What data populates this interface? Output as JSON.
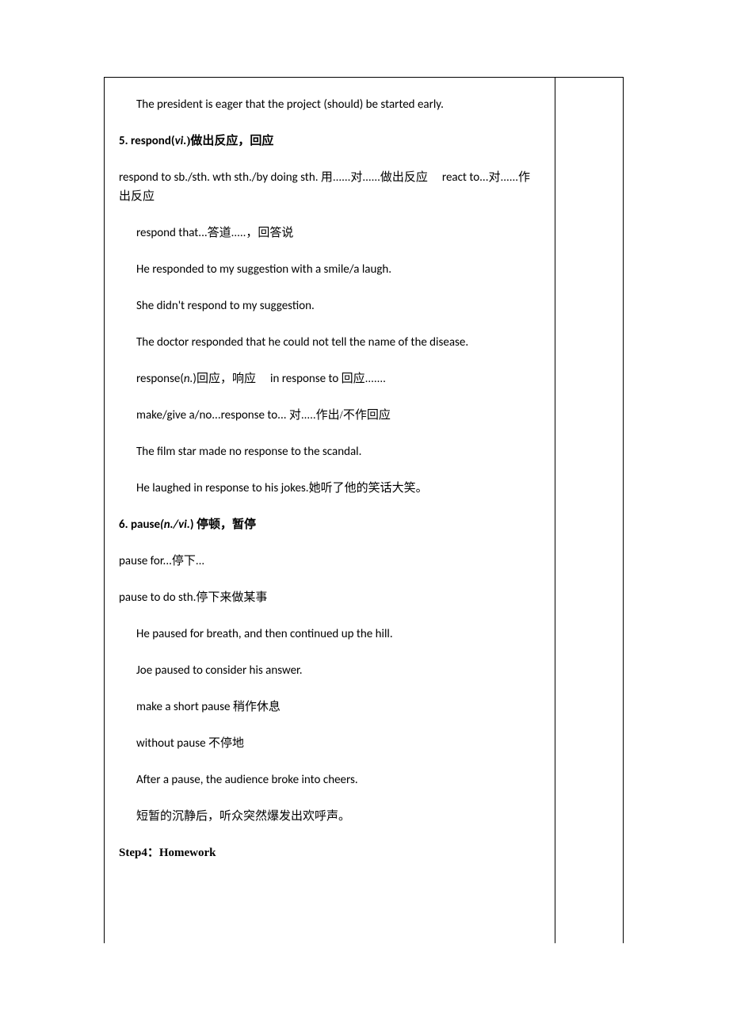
{
  "lines": [
    {
      "indent": true,
      "bold": false,
      "spans": [
        {
          "t": "The president is eager that the project (should) be started early."
        }
      ]
    },
    {
      "indent": false,
      "bold": true,
      "spans": [
        {
          "t": "5. respond("
        },
        {
          "t": "vi.",
          "italic": true
        },
        {
          "t": ")做出反应，回应",
          "cn": true
        }
      ]
    },
    {
      "indent": false,
      "bold": false,
      "spans": [
        {
          "t": "respond to sb./sth. wth sth./by doing sth. "
        },
        {
          "t": "用......对......做出反应",
          "cn": true
        },
        {
          "t": "",
          "gap": true
        },
        {
          "t": "react to..."
        },
        {
          "t": "对......作出反应",
          "cn": true
        }
      ]
    },
    {
      "indent": true,
      "bold": false,
      "spans": [
        {
          "t": "respond that..."
        },
        {
          "t": "答道.....，回答说",
          "cn": true
        }
      ]
    },
    {
      "indent": true,
      "bold": false,
      "spans": [
        {
          "t": "He responded to my suggestion with a smile/a laugh."
        }
      ]
    },
    {
      "indent": true,
      "bold": false,
      "spans": [
        {
          "t": "She didn't respond to my suggestion."
        }
      ]
    },
    {
      "indent": true,
      "bold": false,
      "spans": [
        {
          "t": "The doctor responded that he could not tell the name of the disease."
        }
      ]
    },
    {
      "indent": true,
      "bold": false,
      "spans": [
        {
          "t": "response("
        },
        {
          "t": "n.",
          "italic": true
        },
        {
          "t": ")"
        },
        {
          "t": "回应，响应",
          "cn": true
        },
        {
          "t": "",
          "gap": true
        },
        {
          "t": "in response to "
        },
        {
          "t": "回应.......",
          "cn": true
        }
      ]
    },
    {
      "indent": true,
      "bold": false,
      "spans": [
        {
          "t": "make/give a/no...response to... "
        },
        {
          "t": "对.....作出/不作回应",
          "cn": true
        }
      ]
    },
    {
      "indent": true,
      "bold": false,
      "spans": [
        {
          "t": "The film star made no response to the scandal."
        }
      ]
    },
    {
      "indent": true,
      "bold": false,
      "spans": [
        {
          "t": "He laughed in response to his jokes."
        },
        {
          "t": "她听了他的笑话大笑。",
          "cn": true
        }
      ]
    },
    {
      "indent": false,
      "bold": true,
      "spans": [
        {
          "t": "6. pause"
        },
        {
          "t": "(n./vi.",
          "italic": true
        },
        {
          "t": ") "
        },
        {
          "t": "停顿，暂停",
          "cn": true
        }
      ]
    },
    {
      "indent": false,
      "bold": false,
      "spans": [
        {
          "t": "pause for..."
        },
        {
          "t": "停下...",
          "cn": true
        }
      ]
    },
    {
      "indent": false,
      "bold": false,
      "spans": [
        {
          "t": "pause to do sth."
        },
        {
          "t": "停下来做某事",
          "cn": true
        }
      ]
    },
    {
      "indent": true,
      "bold": false,
      "spans": [
        {
          "t": "He paused for breath, and then continued up the hill."
        }
      ]
    },
    {
      "indent": true,
      "bold": false,
      "spans": [
        {
          "t": "Joe paused to consider his answer."
        }
      ]
    },
    {
      "indent": true,
      "bold": false,
      "spans": [
        {
          "t": "make a short pause   "
        },
        {
          "t": "稍作休息",
          "cn": true
        }
      ]
    },
    {
      "indent": true,
      "bold": false,
      "spans": [
        {
          "t": "without pause "
        },
        {
          "t": "不停地",
          "cn": true
        }
      ]
    },
    {
      "indent": true,
      "bold": false,
      "spans": [
        {
          "t": "After a pause, the audience broke into cheers."
        }
      ]
    },
    {
      "indent": true,
      "bold": false,
      "spans": [
        {
          "t": "短暂的沉静后，听众突然爆发出欢呼声。",
          "cn": true
        }
      ]
    },
    {
      "indent": false,
      "bold": true,
      "spans": [
        {
          "t": "Step4：Homework",
          "cn": true
        }
      ]
    }
  ]
}
